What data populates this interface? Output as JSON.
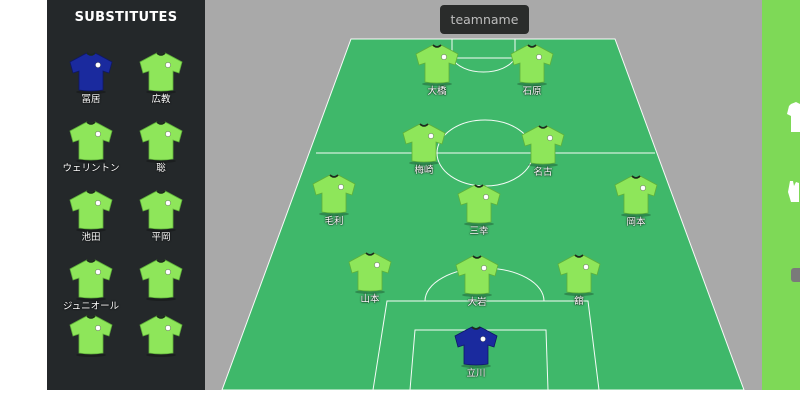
{
  "substitutes": {
    "title": "SUBSTITUTES",
    "players": [
      {
        "name": "冨居",
        "kit": "keeper"
      },
      {
        "name": "広教",
        "kit": "outfield"
      },
      {
        "name": "ウェリントン",
        "kit": "outfield"
      },
      {
        "name": "聡",
        "kit": "outfield"
      },
      {
        "name": "池田",
        "kit": "outfield"
      },
      {
        "name": "平岡",
        "kit": "outfield"
      },
      {
        "name": "ジュニオール",
        "kit": "outfield"
      },
      {
        "name": "",
        "kit": "outfield"
      },
      {
        "name": "",
        "kit": "outfield"
      },
      {
        "name": "",
        "kit": "outfield"
      }
    ]
  },
  "team": {
    "name_placeholder": "teamname"
  },
  "lineup": [
    {
      "name": "大橋",
      "kit": "outfield"
    },
    {
      "name": "石原",
      "kit": "outfield"
    },
    {
      "name": "梅崎",
      "kit": "outfield"
    },
    {
      "name": "名古",
      "kit": "outfield"
    },
    {
      "name": "毛利",
      "kit": "outfield"
    },
    {
      "name": "三幸",
      "kit": "outfield"
    },
    {
      "name": "岡本",
      "kit": "outfield"
    },
    {
      "name": "山本",
      "kit": "outfield"
    },
    {
      "name": "大岩",
      "kit": "outfield"
    },
    {
      "name": "舘",
      "kit": "outfield"
    },
    {
      "name": "立川",
      "kit": "keeper"
    }
  ],
  "colors": {
    "outfield_kit": "#8ee65a",
    "keeper_kit": "#1a2a9e",
    "pitch": "#3fb86a",
    "panel": "#24282a",
    "stage": "#a9a9a9",
    "accent": "#7ed957"
  },
  "icons": {
    "right_panel": [
      "shirt-icon",
      "glove-icon"
    ]
  }
}
